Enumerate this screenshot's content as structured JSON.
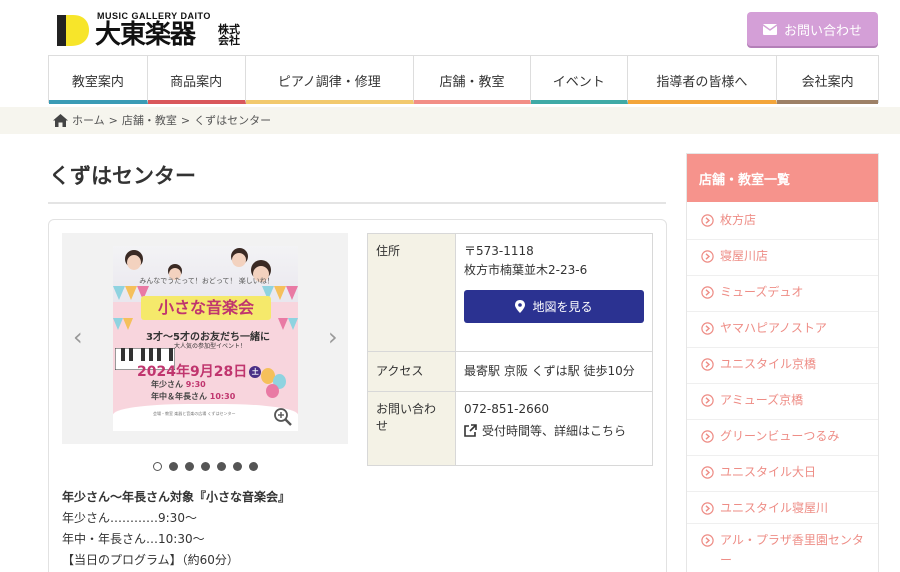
{
  "brand": {
    "sub": "MUSIC GALLERY DAITO",
    "name": "大東楽器",
    "kabushiki": "株式会社",
    "accent": "#f7e52a"
  },
  "header": {
    "contact_label": "お問い合わせ",
    "contact_color": "#d49fd7"
  },
  "nav": {
    "items": [
      {
        "label": "教室案内",
        "color": "#3a9bb5",
        "width": 99
      },
      {
        "label": "商品案内",
        "color": "#d9575b",
        "width": 98
      },
      {
        "label": "ピアノ調律・修理",
        "color": "#f2c96d",
        "width": 169
      },
      {
        "label": "店舗・教室",
        "color": "#f28e86",
        "width": 117
      },
      {
        "label": "イベント",
        "color": "#3faaa6",
        "width": 97
      },
      {
        "label": "指導者の皆様へ",
        "color": "#f3a53a",
        "width": 150
      },
      {
        "label": "会社案内",
        "color": "#9d8066",
        "width": 101
      }
    ]
  },
  "breadcrumb": {
    "home": "ホーム",
    "sep": ">",
    "parent": "店舗・教室",
    "current": "くずはセンター"
  },
  "page": {
    "title": "くずはセンター"
  },
  "slider": {
    "prev": "‹",
    "next": "›",
    "dots_total": 7,
    "active_index": 0,
    "poster": {
      "tagline": "みんなでうたって！おどって！ 楽しいね！",
      "title": "小さな音楽会",
      "age": "3才〜5才のお友だち一緒に",
      "popular": "大人気の参加型イベント！",
      "date": "2024年9月28日",
      "day": "土",
      "time_1_label": "年少さん",
      "time_1": "9:30",
      "time_2_label": "年中＆年長さん",
      "time_2": "10:30",
      "footer": "会場・教室 楽器と音楽の広場 くずはセンター"
    }
  },
  "description": {
    "lines": [
      "年少さん〜年長さん対象『小さな音楽会』",
      "年少さん…………9:30〜",
      "年中・年長さん…10:30〜",
      "【当日のプログラム】（約60分）"
    ]
  },
  "info": {
    "address_label": "住所",
    "postal": "〒573-1118",
    "address": "枚方市楠葉並木2-23-6",
    "map_button": "地図を見る",
    "access_label": "アクセス",
    "access": "最寄駅 京阪 くずは駅 徒歩10分",
    "contact_label": "お問い合わせ",
    "phone": "072-851-2660",
    "contact_link": "受付時間等、詳細はこちら"
  },
  "sidebar": {
    "heading": "店舗・教室一覧",
    "items": [
      "枚方店",
      "寝屋川店",
      "ミューズデュオ",
      "ヤマハピアノストア",
      "ユニスタイル京橋",
      "アミューズ京橋",
      "グリーンビューつるみ",
      "ユニスタイル大日",
      "ユニスタイル寝屋川",
      "アル・プラザ香里園センター"
    ]
  }
}
